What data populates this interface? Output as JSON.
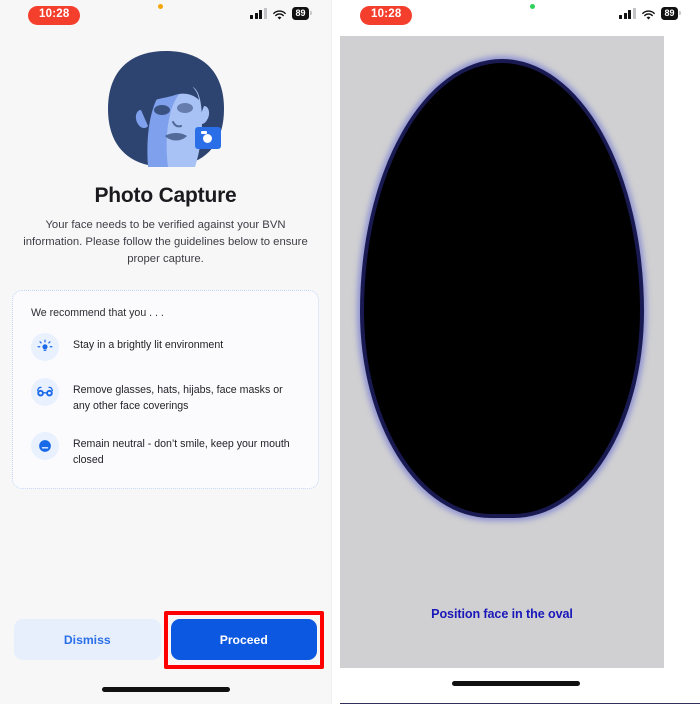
{
  "left_phone": {
    "status_bar": {
      "time": "10:28",
      "privacy_indicator": "microphone-active",
      "privacy_color": "#f6a609",
      "battery_level": "89",
      "signal_icon": "cellular-signal-icon",
      "wifi_icon": "wifi-icon"
    },
    "hero": {
      "illustration_name": "face-photo-capture-illustration",
      "camera_badge_icon": "camera-icon"
    },
    "title": "Photo Capture",
    "subtitle": "Your face needs to be verified against your BVN information. Please follow the guidelines below to ensure proper capture.",
    "card": {
      "heading": "We recommend that you  . . .",
      "tips": [
        {
          "icon": "lightbulb-icon",
          "text": "Stay in a brightly lit environment"
        },
        {
          "icon": "glasses-icon",
          "text": "Remove glasses, hats, hijabs, face masks or any other face coverings"
        },
        {
          "icon": "neutral-face-icon",
          "text": "Remain neutral - don’t smile, keep your mouth closed"
        }
      ]
    },
    "buttons": {
      "dismiss": "Dismiss",
      "proceed": "Proceed"
    },
    "highlight": {
      "target": "proceed-button",
      "color": "#ff0000"
    },
    "home_indicator": "home-indicator"
  },
  "right_phone": {
    "status_bar": {
      "time": "10:28",
      "privacy_indicator": "camera-active",
      "privacy_color": "#30d158",
      "battery_level": "89",
      "signal_icon": "cellular-signal-icon",
      "wifi_icon": "wifi-icon"
    },
    "camera": {
      "background_color": "#d0d0d2",
      "oval_fill_color": "#000000",
      "oval_ring_color": "#8f93d2",
      "hint_text": "Position face in the oval",
      "hint_color": "#1a18b8"
    },
    "home_indicator": "home-indicator"
  }
}
